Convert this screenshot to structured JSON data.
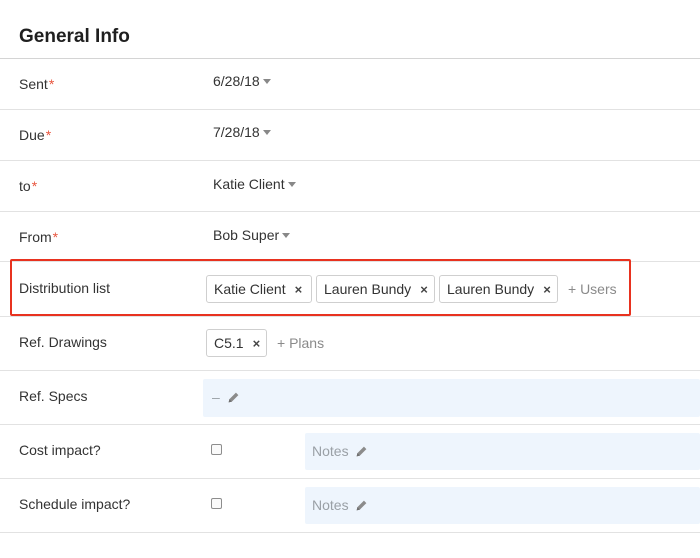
{
  "section": {
    "title": "General Info"
  },
  "fields": {
    "sent": {
      "label": "Sent",
      "required_mark": "*",
      "value": "6/28/18"
    },
    "due": {
      "label": "Due",
      "required_mark": "*",
      "value": "7/28/18"
    },
    "to": {
      "label": "to",
      "required_mark": "*",
      "value": "Katie Client"
    },
    "from": {
      "label": "From",
      "required_mark": "*",
      "value": "Bob Super"
    },
    "distribution": {
      "label": "Distribution list",
      "chips": [
        "Katie Client",
        "Lauren Bundy",
        "Lauren Bundy"
      ],
      "remove_glyph": "×",
      "add_label": "+ Users"
    },
    "ref_drawings": {
      "label": "Ref. Drawings",
      "chips": [
        "C5.1"
      ],
      "remove_glyph": "×",
      "add_label": "+ Plans"
    },
    "ref_specs": {
      "label": "Ref. Specs",
      "value": "–"
    },
    "cost_impact": {
      "label": "Cost impact?",
      "notes_placeholder": "Notes"
    },
    "schedule_impact": {
      "label": "Schedule impact?",
      "notes_placeholder": "Notes"
    }
  },
  "colors": {
    "required": "#e8553e",
    "highlight": "#e8321f",
    "edit_bg": "#eef5fd"
  },
  "icons": {
    "caret": "caret-down-icon",
    "remove": "close-icon",
    "edit": "pencil-icon"
  }
}
